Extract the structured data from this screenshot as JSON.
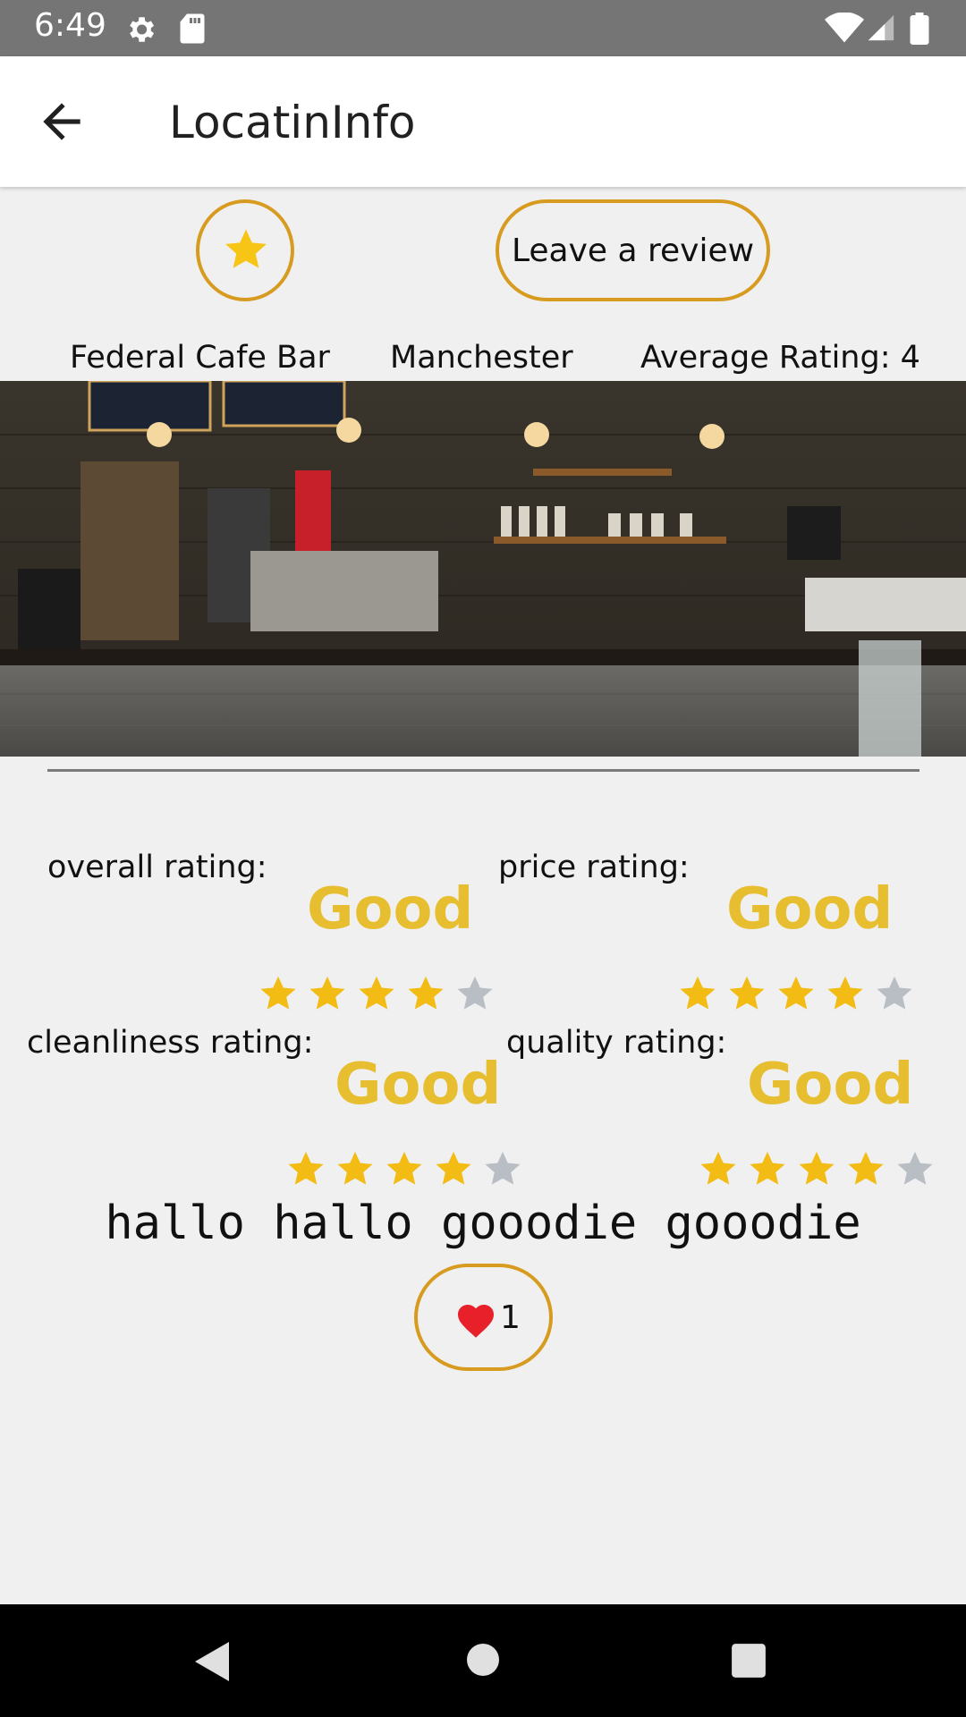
{
  "status_bar": {
    "time": "6:49",
    "icons": [
      "gear-icon",
      "sd-card-icon",
      "wifi-icon",
      "signal-icon",
      "battery-icon"
    ]
  },
  "app_bar": {
    "title": "LocatinInfo",
    "back_icon": "arrow-left-icon"
  },
  "actions": {
    "favorite_icon": "star-icon",
    "review_label": "Leave a review"
  },
  "location": {
    "name": "Federal Cafe Bar",
    "city": "Manchester",
    "average_rating": "Average Rating: 4"
  },
  "photo": {
    "description_icon": "cafe-photo"
  },
  "ratings": {
    "overall": {
      "label": "overall rating:",
      "value_text": "Good",
      "stars": 4,
      "max": 5
    },
    "price": {
      "label": "price rating:",
      "value_text": "Good",
      "stars": 4,
      "max": 5
    },
    "cleanliness": {
      "label": "cleanliness rating:",
      "value_text": "Good",
      "stars": 4,
      "max": 5
    },
    "quality": {
      "label": "quality rating:",
      "value_text": "Good",
      "stars": 4,
      "max": 5
    }
  },
  "review": {
    "comment": "hallo hallo gooodie gooodie",
    "likes": "1",
    "like_icon": "heart-icon"
  },
  "colors": {
    "accent_border": "#d79b1f",
    "star_filled": "#f2bc15",
    "star_empty": "#b8bec4",
    "rating_text": "#e6be2f",
    "heart": "#e8202a"
  }
}
